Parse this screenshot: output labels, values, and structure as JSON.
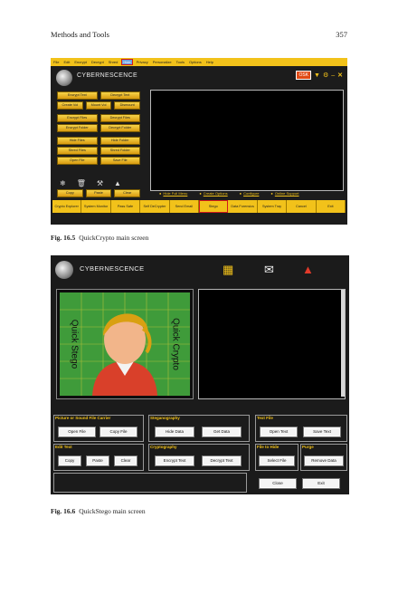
{
  "page": {
    "running_head": "Methods and Tools",
    "page_number": "357"
  },
  "figure1": {
    "label": "Fig. 16.5",
    "caption": "QuickCrypto main screen",
    "menu": [
      "File",
      "Edit",
      "Encrypt",
      "Decrypt",
      "Shred",
      "Hide",
      "Privacy",
      "Personalize",
      "Tools",
      "Options",
      "Help"
    ],
    "highlighted_menu": "Hide",
    "brand": "CYBERNESCENCE",
    "osk": "OSK",
    "buttons": [
      [
        "Encrypt Text",
        "Decrypt Text"
      ],
      [
        "Create Vol",
        "Mount Vol",
        "Dismount"
      ],
      [
        "Encrypt Files",
        "Decrypt Files"
      ],
      [
        "Encrypt Folder",
        "Decrypt Folder"
      ],
      [
        "Hide Files",
        "Hide Folder"
      ],
      [
        "Shred Files",
        "Shred Folder"
      ],
      [
        "Open File",
        "Save File"
      ]
    ],
    "edit_buttons": [
      "Copy",
      "Paste",
      "Clear"
    ],
    "links": [
      "Hide Full Menu",
      "Create Options",
      "Configure",
      "Online Support"
    ],
    "bottom_bar": [
      "Crypto Explorer",
      "System Monitor",
      "Pass Safe",
      "Self DeCrypter",
      "Send Email",
      "Stego",
      "Data Forensics",
      "System Tray",
      "Cancel",
      "Exit"
    ],
    "highlighted_bottom": "Stego",
    "accent": "#f2c21a",
    "highlight_color": "#d21a1a"
  },
  "figure2": {
    "label": "Fig. 16.6",
    "caption": "QuickStego main screen",
    "brand": "CYBERNESCENCE",
    "art_text_left": "Quick Stego",
    "art_text_right": "Quick Crypto",
    "groups": {
      "carrier": {
        "title": "Picture or Sound File Carrier",
        "open": "Open File",
        "copy": "Copy File"
      },
      "edit": {
        "title": "Edit Text",
        "copy": "Copy",
        "paste": "Paste",
        "clear": "Clear"
      },
      "steg": {
        "title": "Steganography",
        "hide": "Hide Data",
        "get": "Get Data"
      },
      "crypto": {
        "title": "Cryptography",
        "encrypt": "Encrypt Text",
        "decrypt": "Decrypt Text"
      },
      "textfile": {
        "title": "Text File",
        "open": "Open Text",
        "save": "Save Text"
      },
      "tohide": {
        "title": "File to Hide",
        "select": "Select File"
      },
      "purge": {
        "title": "Purge",
        "remove": "Remove Data"
      }
    },
    "close": "Close",
    "exit": "Exit",
    "accent": "#f2c21a"
  }
}
